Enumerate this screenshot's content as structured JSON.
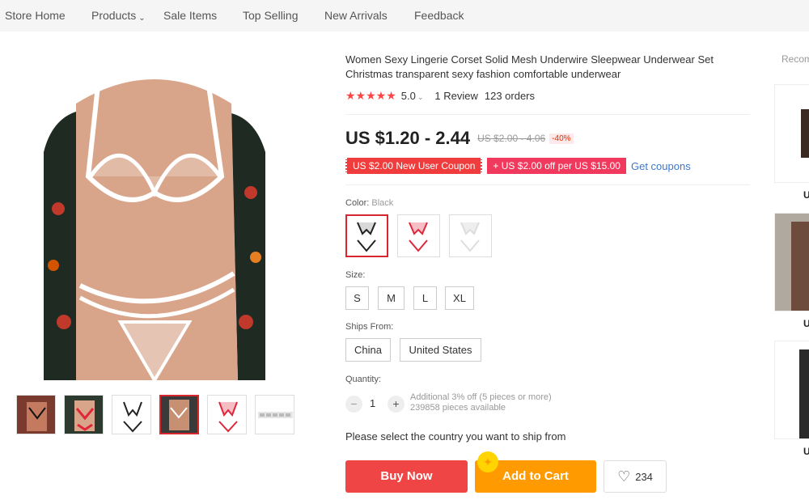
{
  "nav": {
    "items": [
      {
        "label": "Store Home"
      },
      {
        "label": "Products"
      },
      {
        "label": "Sale Items"
      },
      {
        "label": "Top Selling"
      },
      {
        "label": "New Arrivals"
      },
      {
        "label": "Feedback"
      }
    ]
  },
  "product": {
    "title": "Women Sexy Lingerie Corset Solid Mesh Underwire Sleepwear Underwear Set Christmas transparent sexy fashion comfortable underwear",
    "rating": "5.0",
    "reviews": "1 Review",
    "orders": "123 orders",
    "price": "US $1.20 - 2.44",
    "original_price": "US $2.00 - 4.06",
    "discount": "-40%",
    "coupons": [
      "US $2.00 New User Coupon",
      "+ US $2.00 off per US $15.00"
    ],
    "get_coupons": "Get coupons",
    "color_label": "Color:",
    "color_value": "Black",
    "size_label": "Size:",
    "sizes": [
      "S",
      "M",
      "L",
      "XL"
    ],
    "ships_from_label": "Ships From:",
    "ships_from": [
      "China",
      "United States"
    ],
    "quantity_label": "Quantity:",
    "quantity": "1",
    "qty_note_1": "Additional 3% off (5 pieces or more)",
    "qty_note_2": "239858 pieces available",
    "ship_message": "Please select the country you want to ship from",
    "buy_now": "Buy Now",
    "add_to_cart": "Add to Cart",
    "wishlist_count": "234"
  },
  "recommended": {
    "label": "Recom",
    "prices": [
      "U",
      "U",
      "U"
    ]
  },
  "colors": {
    "accent_red": "#f04545",
    "cart_orange": "#ff9a00",
    "star": "#ff4444",
    "link_blue": "#3d78c9"
  }
}
